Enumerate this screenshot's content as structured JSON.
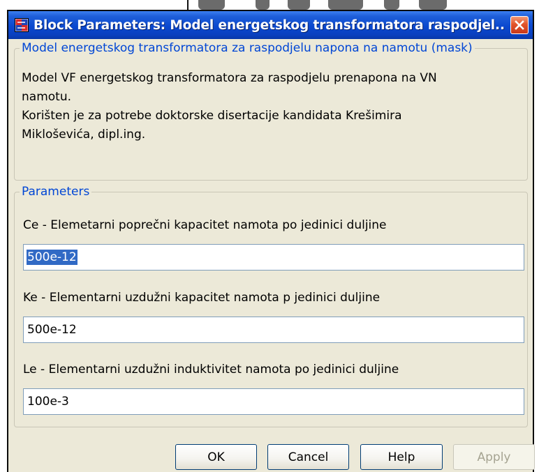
{
  "window": {
    "title": "Block Parameters: Model energetskog transformatora raspodjel...",
    "icon": "simulink-block-icon",
    "close_icon": "close-icon"
  },
  "mask_group": {
    "legend": "Model energetskog transformatora za raspodjelu napona na namotu (mask)",
    "description_lines": [
      "Model VF energetskog transformatora za raspodjelu prenapona na VN",
      "namotu.",
      "Korišten je za potrebe doktorske disertacije kandidata Krešimira",
      "Mikloševića, dipl.ing."
    ]
  },
  "parameters_group": {
    "legend": "Parameters",
    "params": [
      {
        "label": "Ce - Elemetarni poprečni kapacitet namota po jedinici duljine",
        "value": "500e-12",
        "selected": true
      },
      {
        "label": "Ke - Elementarni uzdužni kapacitet namota p jedinici duljine",
        "value": "500e-12",
        "selected": false
      },
      {
        "label": "Le  - Elementarni uzdužni induktivitet namota po jedinici duljine",
        "value": "100e-3",
        "selected": false
      }
    ]
  },
  "buttons": {
    "ok": "OK",
    "cancel": "Cancel",
    "help": "Help",
    "apply": "Apply",
    "apply_enabled": false
  },
  "colors": {
    "titlebar": "#0a48cf",
    "dialog_bg": "#ece9d8",
    "legend_text": "#0046d5",
    "selection": "#316ac5",
    "input_border": "#7f9db9"
  }
}
